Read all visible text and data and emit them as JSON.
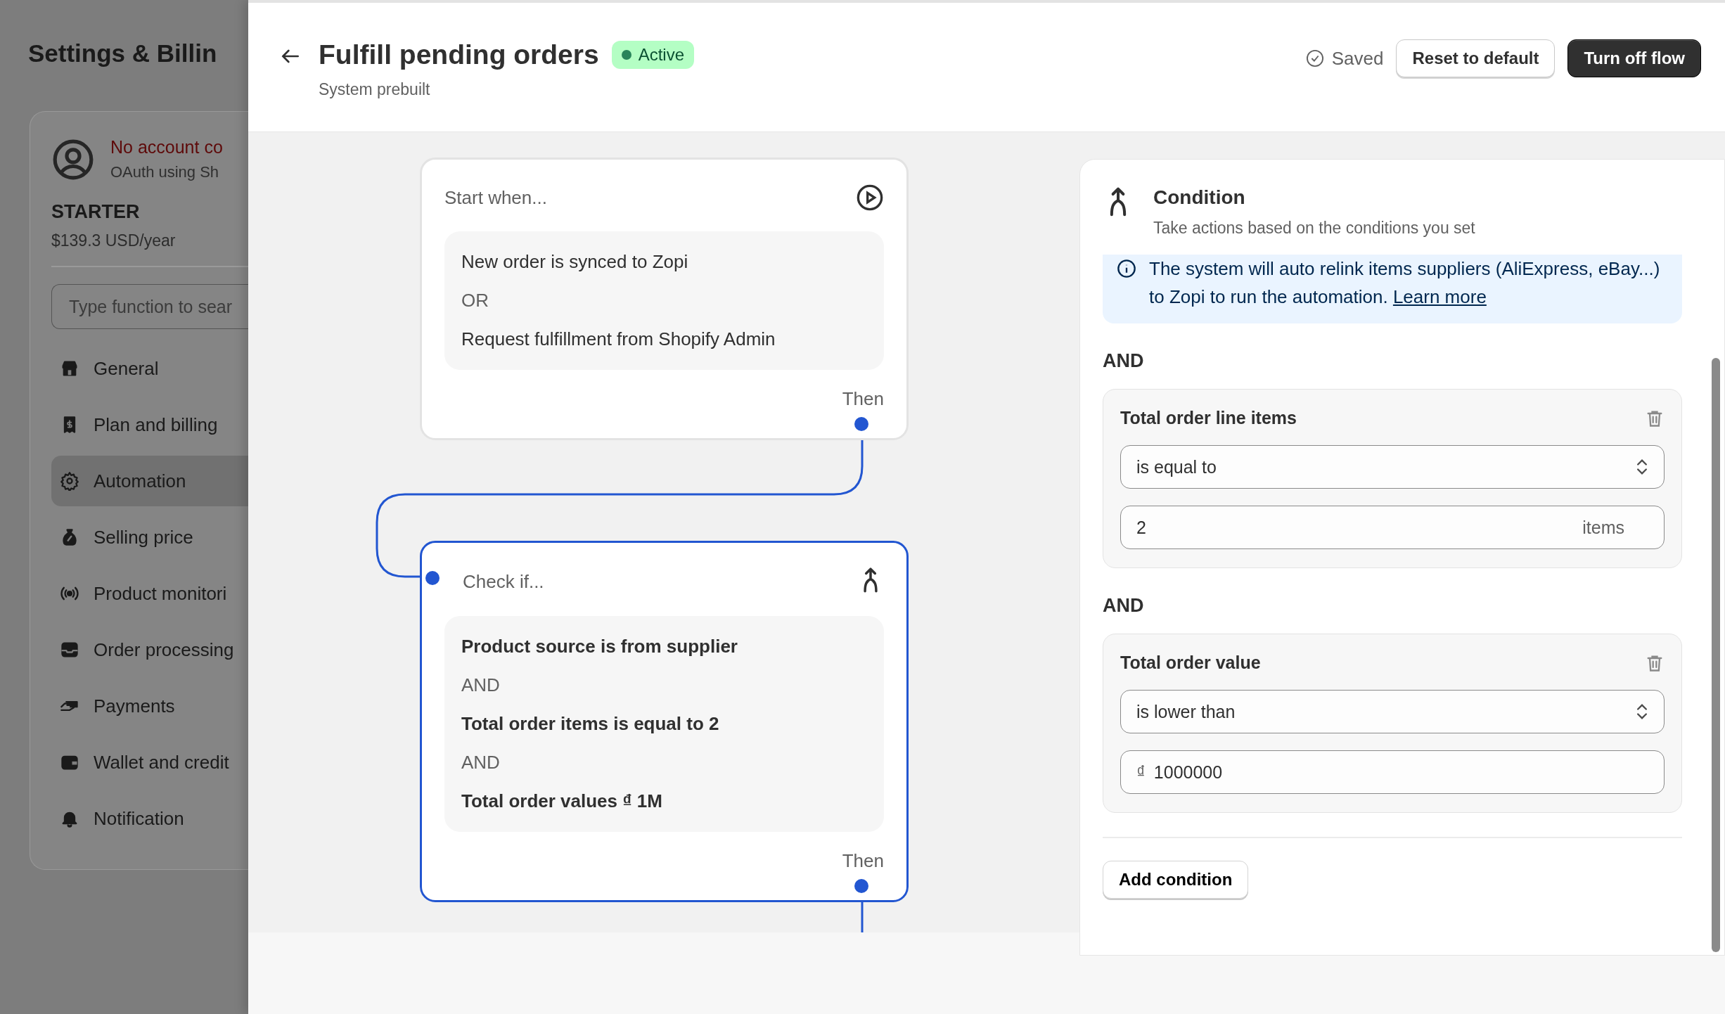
{
  "background_page": {
    "title": "Settings & Billin",
    "account": {
      "status": "No account co",
      "method": "OAuth using Sh"
    },
    "plan": {
      "name": "STARTER",
      "price": "$139.3 USD/year"
    },
    "search": {
      "placeholder": "Type function to sear"
    },
    "nav": [
      {
        "label": "General",
        "selected": false
      },
      {
        "label": "Plan and billing",
        "selected": false
      },
      {
        "label": "Automation",
        "selected": true
      },
      {
        "label": "Selling price",
        "selected": false
      },
      {
        "label": "Product monitori",
        "selected": false
      },
      {
        "label": "Order processing",
        "selected": false
      },
      {
        "label": "Payments",
        "selected": false
      },
      {
        "label": "Wallet and credit",
        "selected": false
      },
      {
        "label": "Notification",
        "selected": false
      }
    ]
  },
  "drawer": {
    "title": "Fulfill pending orders",
    "status": "Active",
    "subtitle": "System prebuilt",
    "saved": "Saved",
    "buttons": [
      {
        "label": "Reset to default",
        "kind": "secondary"
      },
      {
        "label": "Turn off flow",
        "kind": "primary"
      }
    ]
  },
  "flow": {
    "nodes": [
      {
        "kind": "trigger",
        "title": "Start when...",
        "selected": false,
        "footer": "Then",
        "lines": [
          {
            "kind": "item",
            "text": "New order is synced to Zopi"
          },
          {
            "kind": "joiner",
            "text": "OR"
          },
          {
            "kind": "item",
            "text": "Request fulfillment from Shopify Admin"
          }
        ]
      },
      {
        "kind": "condition",
        "title": "Check if...",
        "selected": true,
        "footer": "Then",
        "lines": [
          {
            "kind": "item",
            "text": "Product source is from supplier"
          },
          {
            "kind": "joiner",
            "text": "AND"
          },
          {
            "kind": "item",
            "text": "Total order items is equal to 2"
          },
          {
            "kind": "joiner",
            "text": "AND"
          },
          {
            "kind": "item",
            "text": "Total order values ₫ 1M"
          }
        ]
      }
    ]
  },
  "panel": {
    "title": "Condition",
    "subtitle": "Take actions based on the conditions you set",
    "notice": {
      "text": "The system will auto relink items suppliers (AliExpress, eBay...) to Zopi to run the automation.",
      "link": "Learn more"
    },
    "conditions": [
      {
        "joiner": "AND",
        "field": "Total order line items",
        "operator": "is equal to",
        "value": "2",
        "suffix": "items"
      },
      {
        "joiner": "AND",
        "field": "Total order value",
        "operator": "is lower than",
        "prefix": "₫",
        "value": "1000000"
      }
    ],
    "add_button": "Add condition"
  }
}
